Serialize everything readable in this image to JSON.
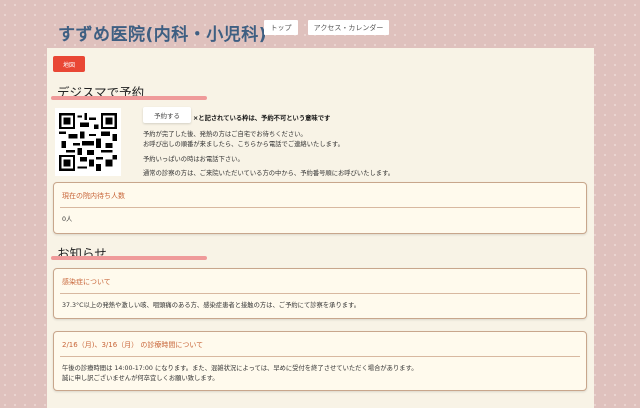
{
  "header": {
    "title": "すずめ医院(内科・小児科)",
    "nav": [
      "トップ",
      "アクセス・カレンダー"
    ]
  },
  "map_button": "地図",
  "reserve": {
    "heading": "デジスマで予約",
    "button": "予約する",
    "notice": "×と記されている枠は、予約不可という意味です",
    "lines": [
      "予約が完了した後、発熱の方はご自宅でお待ちください。",
      "お呼び出しの順番が来ましたら、こちらから電話でご連絡いたします。",
      "予約いっぱいの時はお電話下さい。",
      "通常の診察の方は、ご来院いただいている方の中から、予約番号順にお呼びいたします。"
    ]
  },
  "waiting": {
    "title": "現在の院内待ち人数",
    "value": "0人"
  },
  "news": {
    "heading": "お知らせ",
    "items": [
      {
        "title": "感染症について",
        "body": [
          "37.3°C以上の発熱や激しい咳、咽頭痛のある方、感染症患者と接触の方は、ご予約にて診察を承ります。"
        ]
      },
      {
        "title": "2/16（月)、3/16（月） の診療時間について",
        "body": [
          "午後の診療時間は 14:00-17:00 になります。また、混雑状況によっては、早めに受付を終了させていただく場合があります。",
          "誠に申し訳ございませんが何卒宜しくお願い致します。"
        ]
      }
    ]
  }
}
